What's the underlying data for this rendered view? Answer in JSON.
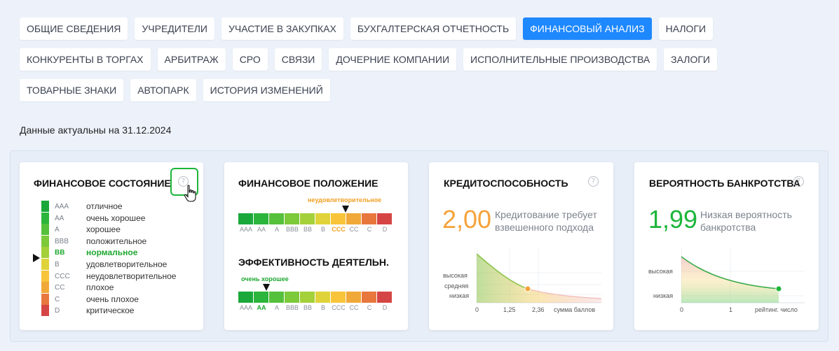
{
  "tabs": {
    "row1": [
      "Общие сведения",
      "Учредители",
      "Участие в закупках",
      "Бухгалтерская отчетность",
      "Финансовый анализ",
      "Налоги"
    ],
    "row2": [
      "Конкуренты в торгах",
      "Арбитраж",
      "СРО",
      "Связи",
      "Дочерние компании",
      "Исполнительные производства",
      "Залоги"
    ],
    "row3": [
      "Товарные знаки",
      "Автопарк",
      "История изменений"
    ],
    "active": "Финансовый анализ"
  },
  "updated_text": "Данные актуальны на 31.12.2024",
  "fin_state": {
    "title": "Финансовое состояние",
    "help": "?",
    "current": "BB",
    "ratings": [
      {
        "code": "AAA",
        "label": "отличное",
        "color": "#1aa83a"
      },
      {
        "code": "AA",
        "label": "очень хорошее",
        "color": "#2cb53c"
      },
      {
        "code": "A",
        "label": "хорошее",
        "color": "#55c03b"
      },
      {
        "code": "BBB",
        "label": "положительное",
        "color": "#7cc93a"
      },
      {
        "code": "BB",
        "label": "нормальное",
        "color": "#a4d03a"
      },
      {
        "code": "B",
        "label": "удовлетворительное",
        "color": "#e0d33a"
      },
      {
        "code": "CCC",
        "label": "неудовлетворительное",
        "color": "#f7c43a"
      },
      {
        "code": "CC",
        "label": "плохое",
        "color": "#f0a838"
      },
      {
        "code": "C",
        "label": "очень плохое",
        "color": "#e8773e"
      },
      {
        "code": "D",
        "label": "критическое",
        "color": "#d64545"
      }
    ]
  },
  "fin_position": {
    "title": "Финансовое положение",
    "note": "неудовлетворительное",
    "highlight": "CCC",
    "codes": [
      "AAA",
      "AA",
      "A",
      "BBB",
      "BB",
      "B",
      "CCC",
      "CC",
      "C",
      "D"
    ],
    "colors": [
      "#1aa83a",
      "#2cb53c",
      "#55c03b",
      "#7cc93a",
      "#a4d03a",
      "#e0d33a",
      "#f7c43a",
      "#f0a838",
      "#e8773e",
      "#d64545"
    ]
  },
  "efficiency": {
    "title": "Эффективность деятельн.",
    "note": "очень хорошее",
    "highlight": "AA"
  },
  "credit": {
    "title": "Кредитоспособность",
    "help": "?",
    "value": "2,00",
    "description_line1": "Кредитование требует",
    "description_line2": "взвешенного подхода",
    "y_labels": [
      "высокая",
      "средняя",
      "низкая"
    ],
    "x_labels": [
      "0",
      "1,25",
      "2,36",
      "сумма баллов"
    ],
    "color": "#f5a23a"
  },
  "bankruptcy": {
    "title": "Вероятность банкротства",
    "help": "?",
    "value": "1,99",
    "description_line1": "Низкая вероятность",
    "description_line2": "банкротства",
    "y_labels": [
      "высокая",
      "низкая"
    ],
    "x_labels": [
      "0",
      "1",
      "рейтинг. число"
    ],
    "color": "#1cb53a"
  }
}
